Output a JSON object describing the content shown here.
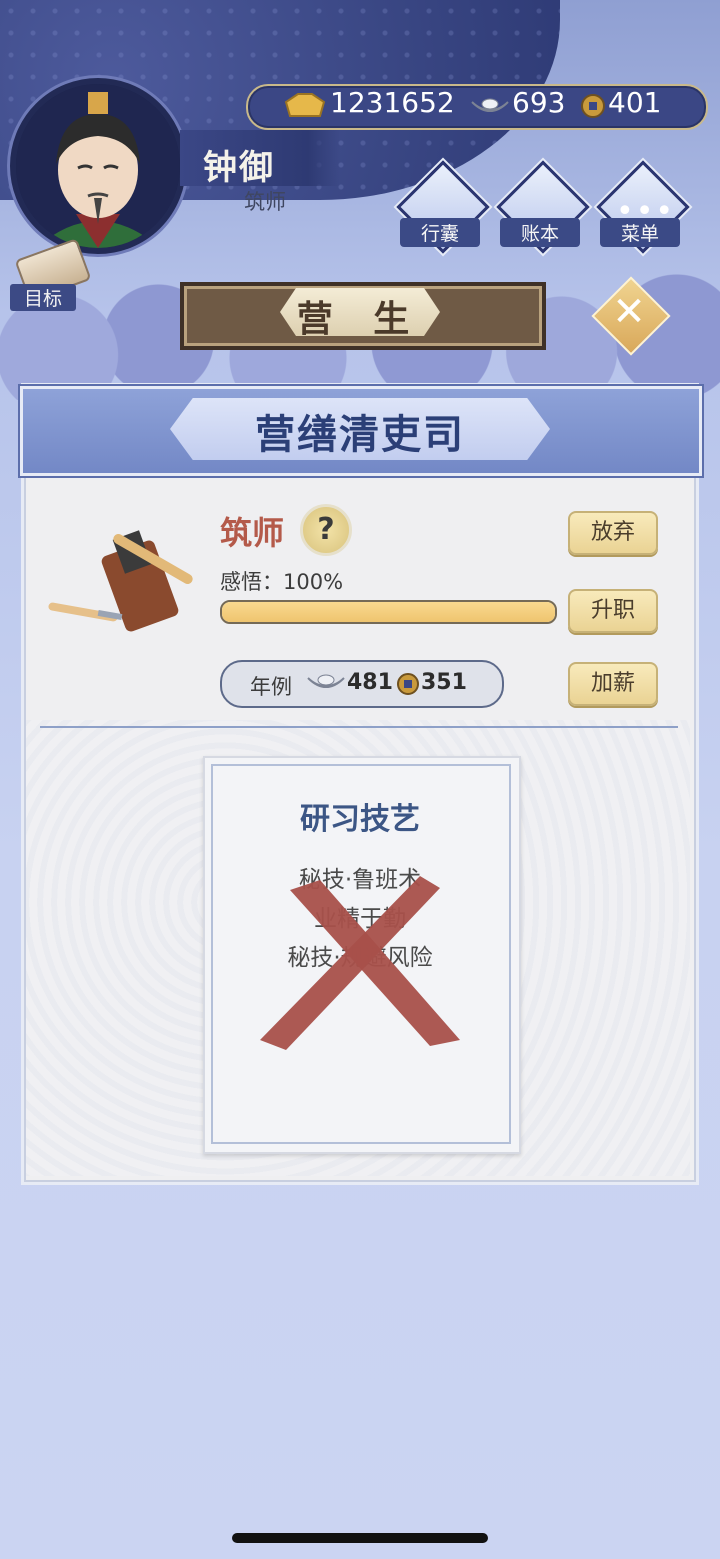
{
  "player": {
    "name": "钟御",
    "title": "筑师"
  },
  "currency": {
    "gold": "1231652",
    "silver": "693",
    "coins": "401"
  },
  "menu": [
    {
      "label": "行囊",
      "icon": "bag-icon"
    },
    {
      "label": "账本",
      "icon": "ledger-icon"
    },
    {
      "label": "菜单",
      "icon": "more-icon"
    }
  ],
  "goal": {
    "label": "目标"
  },
  "section": {
    "title": "营 生"
  },
  "panel": {
    "title": "营缮清吏司",
    "job": {
      "name": "筑师",
      "help": "?",
      "insight_label": "感悟：100%",
      "insight_progress": 1.0,
      "buttons": {
        "quit": "放弃",
        "promote": "升职",
        "raise": "加薪"
      },
      "salary": {
        "label": "年例",
        "silver": "481",
        "coins": "351"
      }
    },
    "card": {
      "title": "研习技艺",
      "lines": [
        "秘技·鲁班术",
        "业精于勤",
        "秘技·规避风险"
      ]
    }
  },
  "colors": {
    "accent": "#3b4785",
    "job_name": "#b45a4a",
    "cross": "#a8504a"
  }
}
